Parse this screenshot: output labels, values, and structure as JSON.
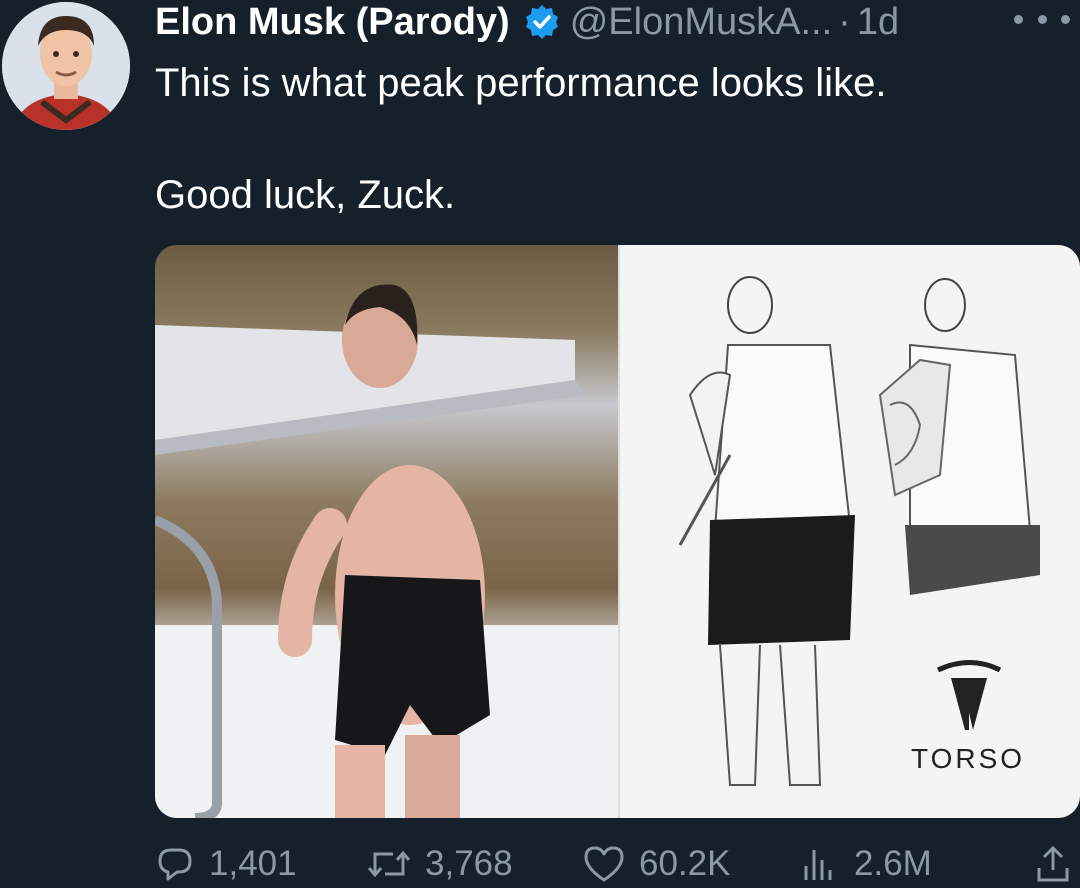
{
  "author": {
    "name": "Elon Musk (Parody)",
    "handle": "@ElonMuskA...",
    "separator": "·",
    "time": "1d"
  },
  "tweet": {
    "line1": "This is what peak performance looks like.",
    "line2": "Good luck, Zuck."
  },
  "media": {
    "sketch_caption": "TORSO"
  },
  "actions": {
    "replies": "1,401",
    "retweets": "3,768",
    "likes": "60.2K",
    "views": "2.6M"
  },
  "colors": {
    "background": "#15202b",
    "secondary_text": "#8b98a5",
    "verified_blue": "#1d9bf0"
  },
  "icons": [
    "verified-badge-icon",
    "more-icon",
    "reply-icon",
    "retweet-icon",
    "like-icon",
    "views-icon",
    "share-icon"
  ]
}
